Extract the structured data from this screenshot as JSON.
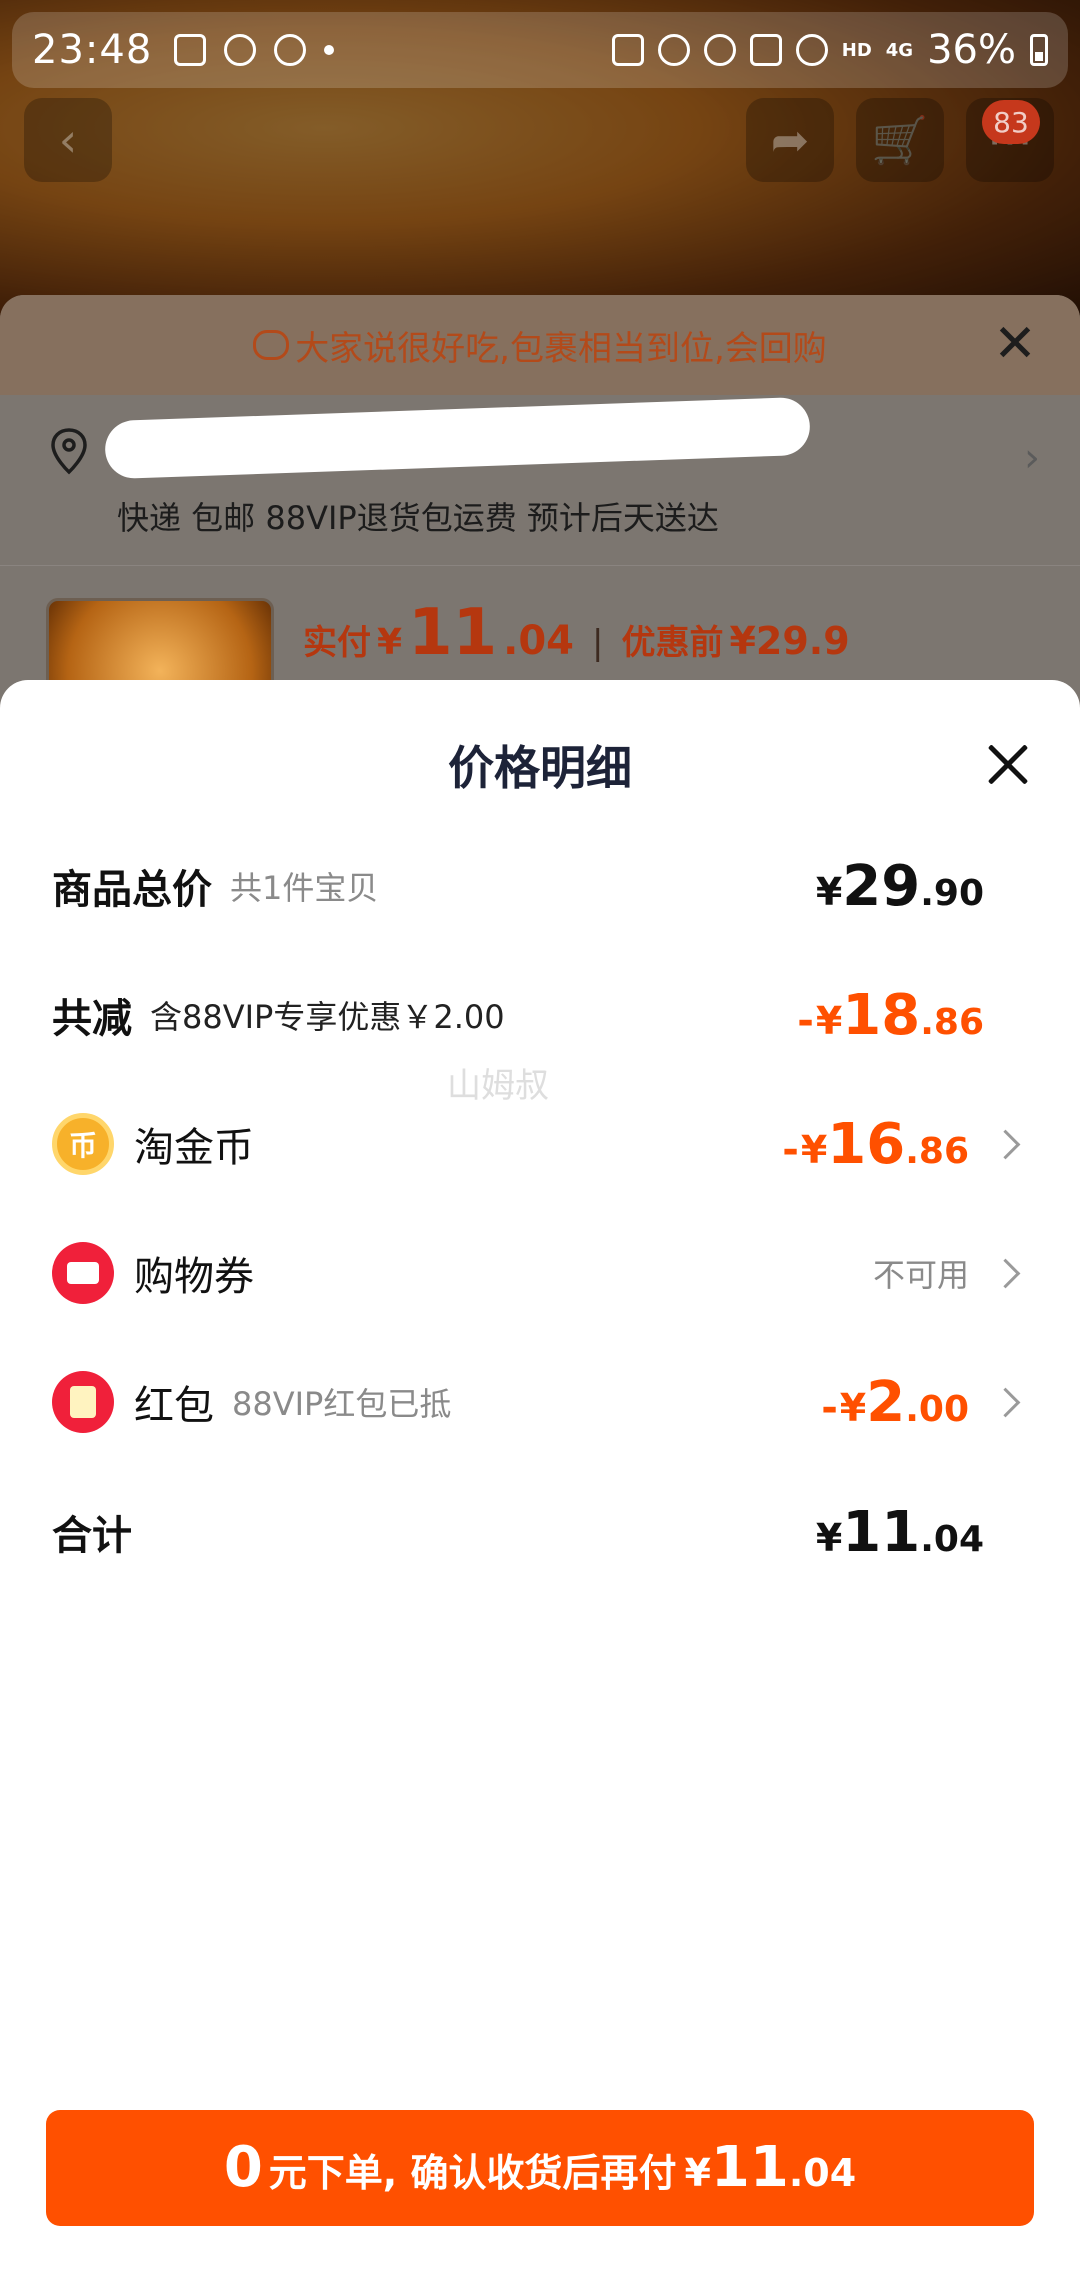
{
  "status_bar": {
    "time": "23:48",
    "battery": "36%",
    "network": "4G",
    "hd": "HD"
  },
  "hero": {
    "cart_badge": "83"
  },
  "order_sheet": {
    "tip": "大家说很好吃,包裹相当到位,会回购",
    "shipping": "快递 包邮 88VIP退货包运费 预计后天送达",
    "paid_label": "实付",
    "paid_yen": "¥",
    "paid_int": "11",
    "paid_dec": ".04",
    "pre_label": "优惠前",
    "pre_value": "¥29.9"
  },
  "detail": {
    "title": "价格明细",
    "rows": [
      {
        "label": "商品总价",
        "sub": "共1件宝贝",
        "yen": "¥",
        "int": "29",
        "dec": ".90"
      },
      {
        "label": "共减",
        "sub": "含88VIP专享优惠￥2.00",
        "minus": "-",
        "yen": "¥",
        "int": "18",
        "dec": ".86"
      },
      {
        "label": "淘金币",
        "icon_glyph": "币",
        "minus": "-",
        "yen": "¥",
        "int": "16",
        "dec": ".86"
      },
      {
        "label": "购物券",
        "status": "不可用"
      },
      {
        "label": "红包",
        "sub": "88VIP红包已抵",
        "minus": "-",
        "yen": "¥",
        "int": "2",
        "dec": ".00"
      },
      {
        "label": "合计",
        "yen": "¥",
        "int": "11",
        "dec": ".04"
      }
    ],
    "watermark": "山姆叔"
  },
  "cta": {
    "big": "0",
    "text": "元下单, 确认收货后再付",
    "yen": "¥",
    "int": "11",
    "dec": ".04"
  },
  "colors": {
    "accent": "#ff5000",
    "title": "#1d2338"
  }
}
